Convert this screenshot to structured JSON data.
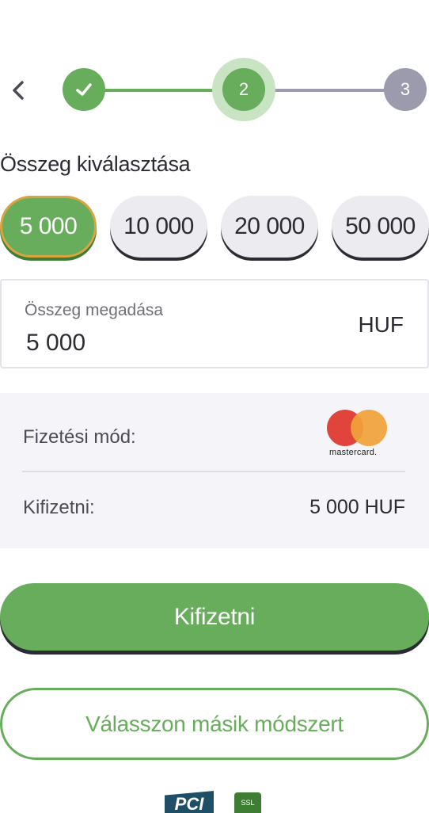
{
  "stepper": {
    "back_icon": "chevron-left-icon",
    "steps": [
      {
        "state": "complete",
        "icon": "check-icon"
      },
      {
        "state": "current",
        "label": "2"
      },
      {
        "state": "upcoming",
        "label": "3"
      }
    ],
    "colors": {
      "active": "#67ad5b",
      "inactive": "#9b9bad",
      "halo": "#c8e4c3"
    }
  },
  "amount_section": {
    "title": "Összeg kiválasztása",
    "options": [
      "5 000",
      "10 000",
      "20 000",
      "50 000"
    ],
    "selected": "5 000"
  },
  "amount_input": {
    "label": "Összeg megadása",
    "value": "5 000",
    "currency": "HUF"
  },
  "summary": {
    "payment_method_label": "Fizetési mód:",
    "payment_method_logo": "mastercard-logo",
    "payment_method_logo_text": "mastercard.",
    "pay_label": "Kifizetni:",
    "pay_amount": "5 000 HUF"
  },
  "actions": {
    "pay_button": "Kifizetni",
    "alt_method_button": "Válasszon másik módszert"
  },
  "badges": {
    "pci_text": "PCI",
    "ssl_text": "SSL"
  },
  "colors": {
    "primary": "#67ad5b",
    "selected_border": "#d9a441",
    "text": "#2b2b33",
    "panel_bg": "#f5f4f8"
  }
}
